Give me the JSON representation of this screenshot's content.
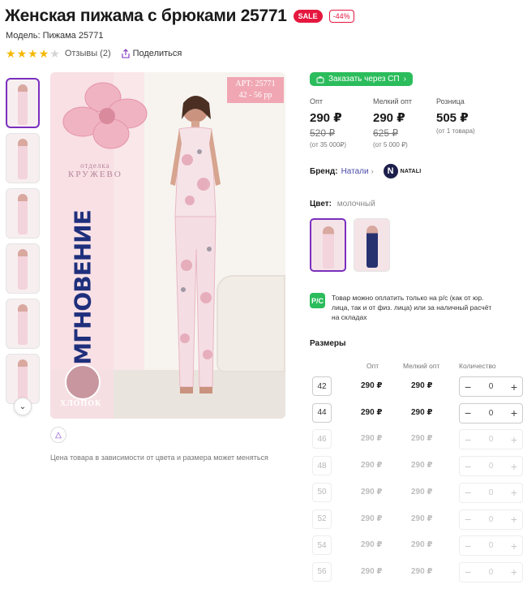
{
  "product": {
    "title": "Женская пижама с брюками 25771",
    "sale_badge": "SALE",
    "discount_badge": "-44%",
    "model_line": "Модель: Пижама 25771",
    "rating": 4,
    "reviews_label": "Отзывы (2)",
    "share_label": "Поделиться"
  },
  "gallery": {
    "thumbs": [
      {
        "style": "light",
        "active": true
      },
      {
        "style": "light",
        "active": false
      },
      {
        "style": "light",
        "active": false
      },
      {
        "style": "light",
        "active": false
      },
      {
        "style": "light",
        "active": false
      },
      {
        "style": "light",
        "active": false
      }
    ],
    "main_image": {
      "art_line1": "АРТ:  25771",
      "art_line2": "42 - 56 рр",
      "lace_small": "отделка",
      "lace_big": "КРУЖЕВО",
      "collection_text": "МГНОВЕНИЕ",
      "cotton_label": "ХЛОПОК"
    },
    "price_note": "Цена товара в зависимости от цвета и размера может меняться"
  },
  "buy": {
    "sp_button": "Заказать через СП",
    "prices": [
      {
        "label": "Опт",
        "now": "290 ₽",
        "old": "520 ₽",
        "note": "(от 35 000₽)"
      },
      {
        "label": "Мелкий опт",
        "now": "290 ₽",
        "old": "625 ₽",
        "note": "(от 5 000 ₽)"
      },
      {
        "label": "Розница",
        "now": "505 ₽",
        "old": "",
        "note": "(от 1 товара)"
      }
    ]
  },
  "brand": {
    "label": "Бренд:",
    "name_link": "Натали",
    "logo_letter": "N",
    "logo_name": "NATALI"
  },
  "color": {
    "label": "Цвет:",
    "value": "молочный",
    "swatches": [
      {
        "style": "light",
        "active": true
      },
      {
        "style": "dark",
        "active": false
      }
    ]
  },
  "payment": {
    "icon_text": "Р/С",
    "note": "Товар можно оплатить только на р/с (как от юр. лица, так и от физ. лица) или за наличный расчёт на складах"
  },
  "sizes": {
    "title": "Размеры",
    "headers": {
      "opt": "Опт",
      "small": "Мелкий опт",
      "qty": "Количество"
    },
    "rows": [
      {
        "size": "42",
        "opt": "290 ₽",
        "small": "290 ₽",
        "qty": "0",
        "enabled": true
      },
      {
        "size": "44",
        "opt": "290 ₽",
        "small": "290 ₽",
        "qty": "0",
        "enabled": true
      },
      {
        "size": "46",
        "opt": "290 ₽",
        "small": "290 ₽",
        "qty": "0",
        "enabled": false
      },
      {
        "size": "48",
        "opt": "290 ₽",
        "small": "290 ₽",
        "qty": "0",
        "enabled": false
      },
      {
        "size": "50",
        "opt": "290 ₽",
        "small": "290 ₽",
        "qty": "0",
        "enabled": false
      },
      {
        "size": "52",
        "opt": "290 ₽",
        "small": "290 ₽",
        "qty": "0",
        "enabled": false
      },
      {
        "size": "54",
        "opt": "290 ₽",
        "small": "290 ₽",
        "qty": "0",
        "enabled": false
      },
      {
        "size": "56",
        "opt": "290 ₽",
        "small": "290 ₽",
        "qty": "0",
        "enabled": false
      }
    ]
  },
  "colors": {
    "accent": "#7b2fbe",
    "sale": "#e5173f",
    "green": "#2bbc5c",
    "star": "#f5b800"
  }
}
